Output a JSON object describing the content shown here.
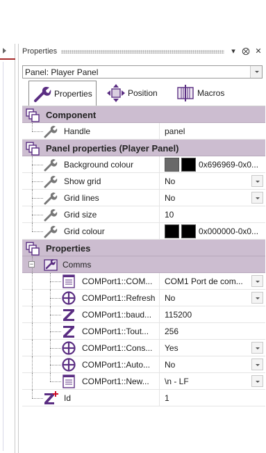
{
  "panel": {
    "title": "Properties",
    "selector_value": "Panel: Player Panel",
    "tabs": [
      {
        "label": "Properties",
        "icon": "wrench-icon"
      },
      {
        "label": "Position",
        "icon": "move-arrows-icon"
      },
      {
        "label": "Macros",
        "icon": "macro-icon"
      }
    ]
  },
  "sections": {
    "component": {
      "title": "Component",
      "handle_label": "Handle",
      "handle_value": "panel"
    },
    "panel_properties": {
      "title": "Panel properties (Player Panel)",
      "background_colour_label": "Background colour",
      "background_colour_value": "0x696969-0x0...",
      "show_grid_label": "Show grid",
      "show_grid_value": "No",
      "grid_lines_label": "Grid lines",
      "grid_lines_value": "No",
      "grid_size_label": "Grid size",
      "grid_size_value": "10",
      "grid_colour_label": "Grid colour",
      "grid_colour_value": "0x000000-0x0..."
    },
    "properties": {
      "title": "Properties",
      "comms_label": "Comms",
      "items": [
        {
          "label": "COMPort1::COM...",
          "value": "COM1 Port de com...",
          "icon": "list-icon"
        },
        {
          "label": "COMPort1::Refresh",
          "value": "No",
          "icon": "plus-circle-icon"
        },
        {
          "label": "COMPort1::baud...",
          "value": "115200",
          "icon": "z-icon"
        },
        {
          "label": "COMPort1::Tout...",
          "value": "256",
          "icon": "z-icon"
        },
        {
          "label": "COMPort1::Cons...",
          "value": "Yes",
          "icon": "plus-circle-icon"
        },
        {
          "label": "COMPort1::Auto...",
          "value": "No",
          "icon": "plus-circle-icon"
        },
        {
          "label": "COMPort1::New...",
          "value": "\\n - LF",
          "icon": "list-icon"
        }
      ],
      "id_label": "Id",
      "id_value": "1"
    }
  },
  "colors": {
    "category_bg": "#ccbdd0",
    "icon_purple": "#5a2d82",
    "swatch_bg1": "#696969",
    "swatch_bg2": "#000000",
    "swatch_grid1": "#000000",
    "swatch_grid2": "#000000"
  }
}
